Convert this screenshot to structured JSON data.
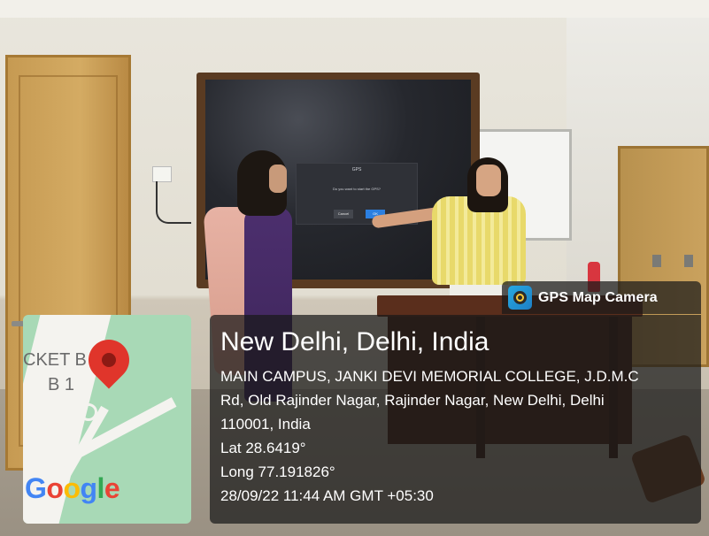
{
  "tv_dialog": {
    "title": "GPS",
    "message": "Do you want to start the GPS?",
    "cancel_label": "Cancel",
    "ok_label": "OK"
  },
  "brand": {
    "name": "GPS Map Camera",
    "icon": "gps-map-camera-icon"
  },
  "location": {
    "title": "New Delhi, Delhi, India",
    "address_lines": [
      "MAIN CAMPUS, JANKI DEVI MEMORIAL COLLEGE, J.D.M.C",
      "Rd, Old Rajinder Nagar, Rajinder Nagar, New Delhi, Delhi",
      "110001, India"
    ],
    "lat": "Lat 28.6419°",
    "long": "Long 77.191826°",
    "timestamp": "28/09/22 11:44 AM GMT +05:30"
  },
  "map": {
    "label_1": "CKET B",
    "label_2": "B 1",
    "google_letters": [
      "G",
      "o",
      "o",
      "g",
      "l",
      "e"
    ],
    "pin_icon": "map-pin-icon"
  },
  "colors": {
    "overlay_bg": "#191919",
    "pin_red": "#e0352b",
    "map_green": "#a8d9b6",
    "dialog_ok_blue": "#2b7fe0"
  }
}
